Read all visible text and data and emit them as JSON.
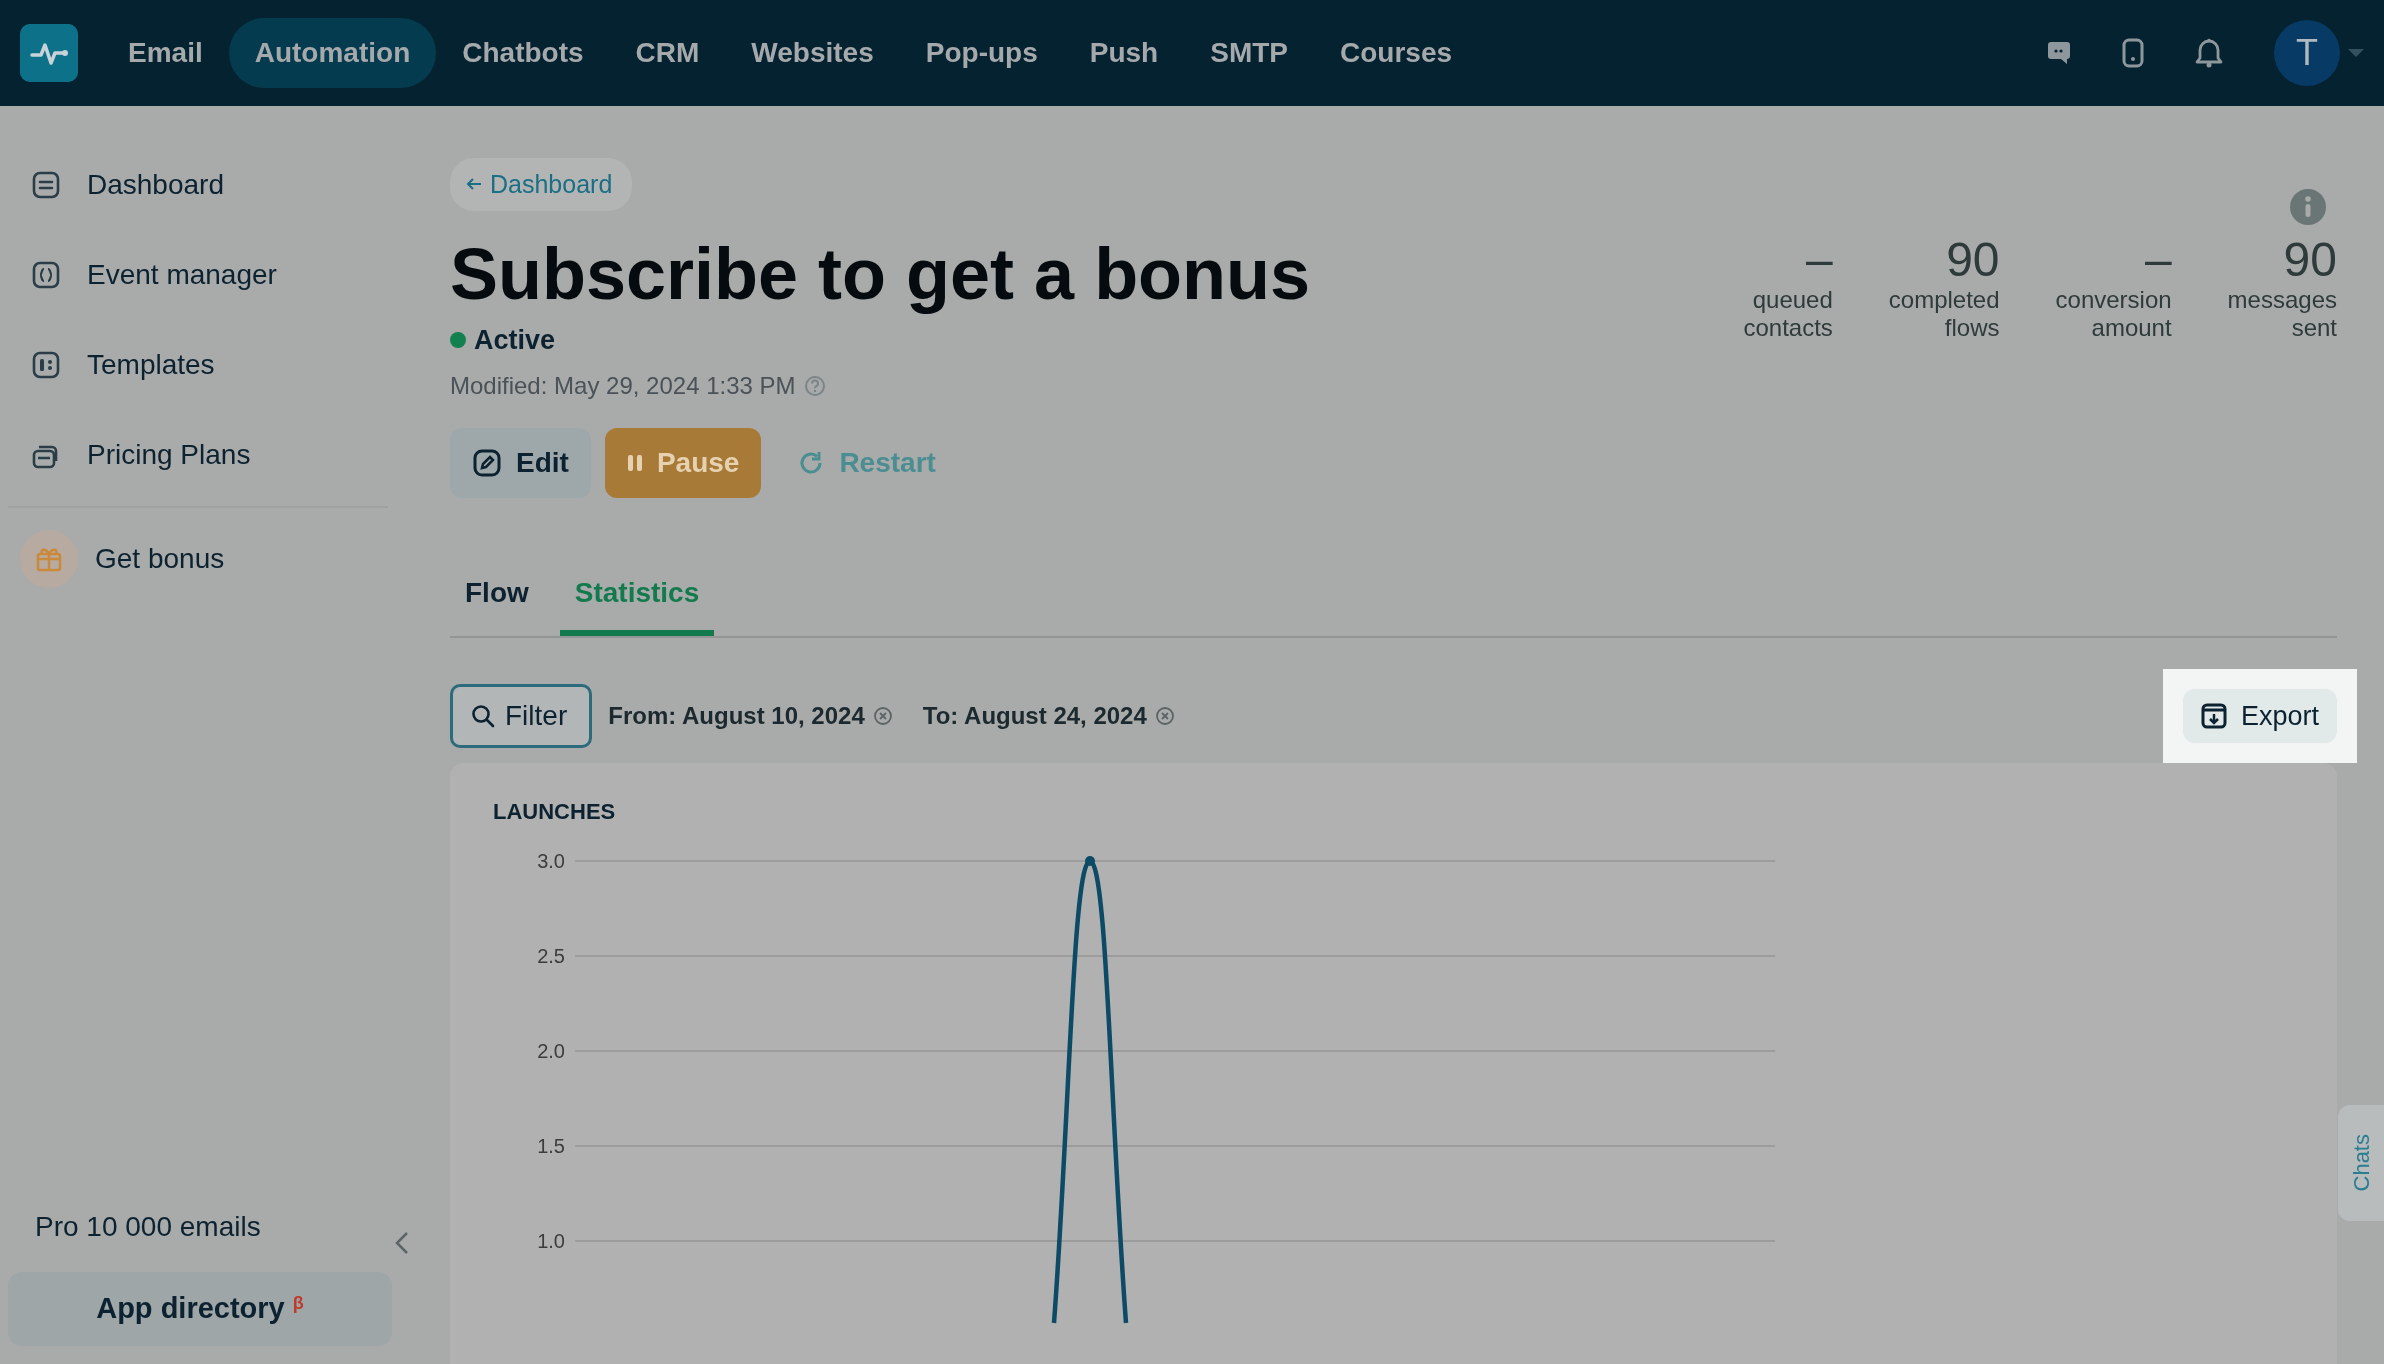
{
  "nav": {
    "items": [
      {
        "label": "Email",
        "selected": false
      },
      {
        "label": "Automation",
        "selected": true
      },
      {
        "label": "Chatbots",
        "selected": false
      },
      {
        "label": "CRM",
        "selected": false
      },
      {
        "label": "Websites",
        "selected": false
      },
      {
        "label": "Pop-ups",
        "selected": false
      },
      {
        "label": "Push",
        "selected": false
      },
      {
        "label": "SMTP",
        "selected": false
      },
      {
        "label": "Courses",
        "selected": false
      }
    ],
    "avatar": "T"
  },
  "sidebar": {
    "items": [
      {
        "label": "Dashboard",
        "kind": "dashboard"
      },
      {
        "label": "Event manager",
        "kind": "events"
      },
      {
        "label": "Templates",
        "kind": "templates"
      },
      {
        "label": "Pricing Plans",
        "kind": "pricing"
      }
    ],
    "bonus": "Get bonus",
    "plan": "Pro 10 000 emails",
    "app_directory": "App directory $^{β}$"
  },
  "page": {
    "back_link": "Dashboard",
    "title": "Subscribe to get a bonus",
    "status": "Active",
    "modified": "Modified: May 29, 2024 1:33 PM",
    "actions": [
      {
        "label": "Edit",
        "kind": "edit"
      },
      {
        "label": "Pause",
        "kind": "pause"
      },
      {
        "label": "Restart",
        "kind": "restart"
      }
    ],
    "stats": [
      {
        "value": "–",
        "label": "queued contacts"
      },
      {
        "value": "90",
        "label": "completed flows"
      },
      {
        "value": "–",
        "label": "conversion amount"
      },
      {
        "value": "90",
        "label": "messages sent"
      }
    ],
    "tabs": [
      {
        "label": "Flow",
        "selected": false
      },
      {
        "label": "Statistics",
        "selected": true
      }
    ],
    "filter": {
      "label": "Filter",
      "chips": [
        "From: August 10, 2024",
        "To: August 24, 2024"
      ]
    },
    "export": {
      "label": "Export",
      "highlighted": true
    },
    "chart": {
      "title": "LAUNCHES",
      "y_axis_labels": [
        "3.0",
        "2.5",
        "2.0",
        "1.5",
        "1.0"
      ]
    }
  },
  "chats_tab": "Chats"
}
